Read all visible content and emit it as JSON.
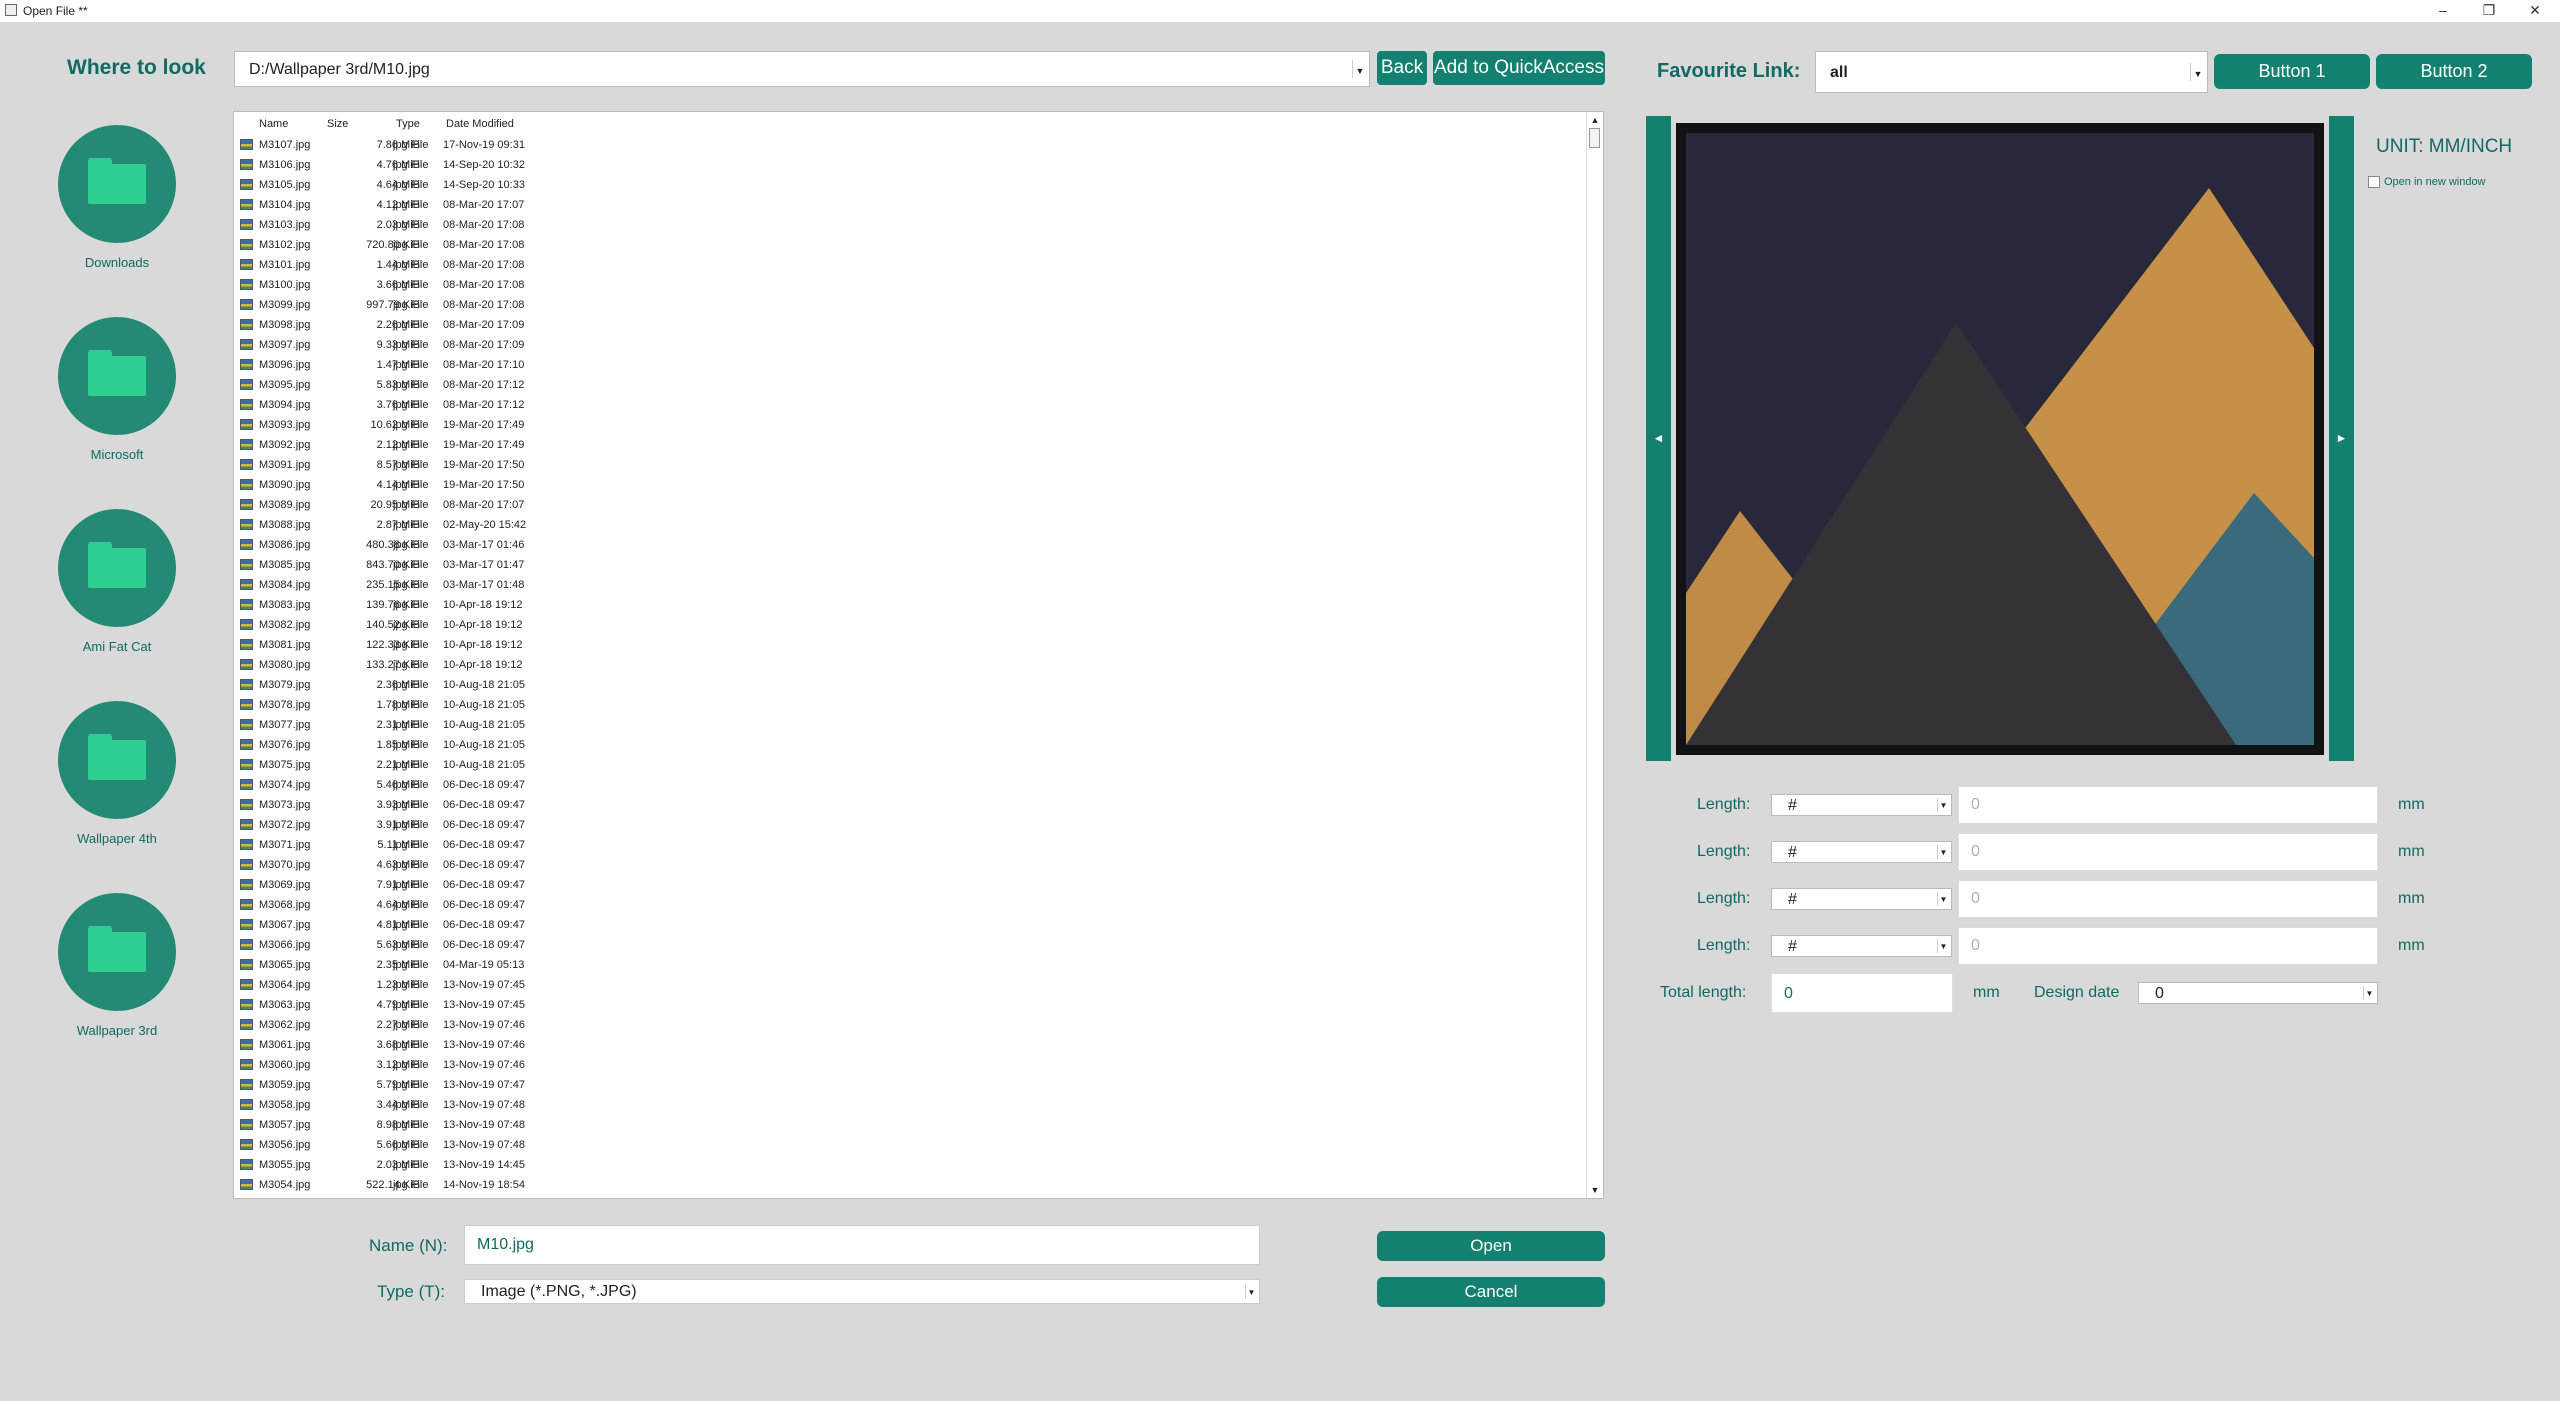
{
  "window": {
    "title": "Open File **",
    "minimize": "–",
    "maximize": "❐",
    "close": "✕"
  },
  "left": {
    "where_label": "Where to look",
    "quick_access": [
      {
        "label": "Downloads"
      },
      {
        "label": "Microsoft"
      },
      {
        "label": "Ami Fat Cat"
      },
      {
        "label": "Wallpaper 4th"
      },
      {
        "label": "Wallpaper 3rd"
      }
    ]
  },
  "path": {
    "value": "D:/Wallpaper 3rd/M10.jpg",
    "back_label": "Back",
    "add_quick_access_label": "Add to QuickAccess"
  },
  "files": {
    "headers": {
      "name": "Name",
      "size": "Size",
      "type": "Type",
      "date": "Date Modified"
    },
    "rows": [
      [
        "M3107.jpg",
        "7.86 MiB",
        "jpg File",
        "17-Nov-19 09:31"
      ],
      [
        "M3106.jpg",
        "4.76 MiB",
        "jpg File",
        "14-Sep-20 10:32"
      ],
      [
        "M3105.jpg",
        "4.64 MiB",
        "jpg File",
        "14-Sep-20 10:33"
      ],
      [
        "M3104.jpg",
        "4.12 MiB",
        "jpg File",
        "08-Mar-20 17:07"
      ],
      [
        "M3103.jpg",
        "2.03 MiB",
        "jpg File",
        "08-Mar-20 17:08"
      ],
      [
        "M3102.jpg",
        "720.80 KiB",
        "jpg File",
        "08-Mar-20 17:08"
      ],
      [
        "M3101.jpg",
        "1.44 MiB",
        "jpg File",
        "08-Mar-20 17:08"
      ],
      [
        "M3100.jpg",
        "3.66 MiB",
        "jpg File",
        "08-Mar-20 17:08"
      ],
      [
        "M3099.jpg",
        "997.79 KiB",
        "jpg File",
        "08-Mar-20 17:08"
      ],
      [
        "M3098.jpg",
        "2.26 MiB",
        "jpg File",
        "08-Mar-20 17:09"
      ],
      [
        "M3097.jpg",
        "9.33 MiB",
        "jpg File",
        "08-Mar-20 17:09"
      ],
      [
        "M3096.jpg",
        "1.47 MiB",
        "jpg File",
        "08-Mar-20 17:10"
      ],
      [
        "M3095.jpg",
        "5.83 MiB",
        "jpg File",
        "08-Mar-20 17:12"
      ],
      [
        "M3094.jpg",
        "3.76 MiB",
        "jpg File",
        "08-Mar-20 17:12"
      ],
      [
        "M3093.jpg",
        "10.62 MiB",
        "jpg File",
        "19-Mar-20 17:49"
      ],
      [
        "M3092.jpg",
        "2.12 MiB",
        "jpg File",
        "19-Mar-20 17:49"
      ],
      [
        "M3091.jpg",
        "8.57 MiB",
        "jpg File",
        "19-Mar-20 17:50"
      ],
      [
        "M3090.jpg",
        "4.14 MiB",
        "jpg File",
        "19-Mar-20 17:50"
      ],
      [
        "M3089.jpg",
        "20.95 MiB",
        "jpg File",
        "08-Mar-20 17:07"
      ],
      [
        "M3088.jpg",
        "2.87 MiB",
        "jpg File",
        "02-May-20 15:42"
      ],
      [
        "M3086.jpg",
        "480.38 KiB",
        "jpg File",
        "03-Mar-17 01:46"
      ],
      [
        "M3085.jpg",
        "843.70 KiB",
        "jpg File",
        "03-Mar-17 01:47"
      ],
      [
        "M3084.jpg",
        "235.15 KiB",
        "jpg File",
        "03-Mar-17 01:48"
      ],
      [
        "M3083.jpg",
        "139.76 KiB",
        "jpg File",
        "10-Apr-18 19:12"
      ],
      [
        "M3082.jpg",
        "140.52 KiB",
        "jpg File",
        "10-Apr-18 19:12"
      ],
      [
        "M3081.jpg",
        "122.33 KiB",
        "jpg File",
        "10-Apr-18 19:12"
      ],
      [
        "M3080.jpg",
        "133.27 KiB",
        "jpg File",
        "10-Apr-18 19:12"
      ],
      [
        "M3079.jpg",
        "2.36 MiB",
        "jpg File",
        "10-Aug-18 21:05"
      ],
      [
        "M3078.jpg",
        "1.78 MiB",
        "jpg File",
        "10-Aug-18 21:05"
      ],
      [
        "M3077.jpg",
        "2.31 MiB",
        "jpg File",
        "10-Aug-18 21:05"
      ],
      [
        "M3076.jpg",
        "1.85 MiB",
        "jpg File",
        "10-Aug-18 21:05"
      ],
      [
        "M3075.jpg",
        "2.21 MiB",
        "jpg File",
        "10-Aug-18 21:05"
      ],
      [
        "M3074.jpg",
        "5.46 MiB",
        "jpg File",
        "06-Dec-18 09:47"
      ],
      [
        "M3073.jpg",
        "3.93 MiB",
        "jpg File",
        "06-Dec-18 09:47"
      ],
      [
        "M3072.jpg",
        "3.91 MiB",
        "jpg File",
        "06-Dec-18 09:47"
      ],
      [
        "M3071.jpg",
        "5.11 MiB",
        "jpg File",
        "06-Dec-18 09:47"
      ],
      [
        "M3070.jpg",
        "4.63 MiB",
        "jpg File",
        "06-Dec-18 09:47"
      ],
      [
        "M3069.jpg",
        "7.91 MiB",
        "jpg File",
        "06-Dec-18 09:47"
      ],
      [
        "M3068.jpg",
        "4.64 MiB",
        "jpg File",
        "06-Dec-18 09:47"
      ],
      [
        "M3067.jpg",
        "4.81 MiB",
        "jpg File",
        "06-Dec-18 09:47"
      ],
      [
        "M3066.jpg",
        "5.63 MiB",
        "jpg File",
        "06-Dec-18 09:47"
      ],
      [
        "M3065.jpg",
        "2.35 MiB",
        "jpg File",
        "04-Mar-19 05:13"
      ],
      [
        "M3064.jpg",
        "1.23 MiB",
        "jpg File",
        "13-Nov-19 07:45"
      ],
      [
        "M3063.jpg",
        "4.79 MiB",
        "jpg File",
        "13-Nov-19 07:45"
      ],
      [
        "M3062.jpg",
        "2.27 MiB",
        "jpg File",
        "13-Nov-19 07:46"
      ],
      [
        "M3061.jpg",
        "3.68 MiB",
        "jpg File",
        "13-Nov-19 07:46"
      ],
      [
        "M3060.jpg",
        "3.12 MiB",
        "jpg File",
        "13-Nov-19 07:46"
      ],
      [
        "M3059.jpg",
        "5.79 MiB",
        "jpg File",
        "13-Nov-19 07:47"
      ],
      [
        "M3058.jpg",
        "3.44 MiB",
        "jpg File",
        "13-Nov-19 07:48"
      ],
      [
        "M3057.jpg",
        "8.98 MiB",
        "jpg File",
        "13-Nov-19 07:48"
      ],
      [
        "M3056.jpg",
        "5.66 MiB",
        "jpg File",
        "13-Nov-19 07:48"
      ],
      [
        "M3055.jpg",
        "2.03 MiB",
        "jpg File",
        "13-Nov-19 14:45"
      ],
      [
        "M3054.jpg",
        "522.14 KiB",
        "jpg File",
        "14-Nov-19 18:54"
      ]
    ]
  },
  "bottom": {
    "name_label": "Name (N):",
    "name_value": "M10.jpg",
    "type_label": "Type (T):",
    "type_value": "Image (*.PNG, *.JPG)",
    "open_label": "Open",
    "cancel_label": "Cancel"
  },
  "right": {
    "favourite_label": "Favourite Link:",
    "favourite_value": "all",
    "button1_label": "Button 1",
    "button2_label": "Button 2",
    "unit_label": "UNIT: MM/INCH",
    "open_new_window_label": "Open in new window",
    "prev_glyph": "◄",
    "next_glyph": "►",
    "lengths": [
      {
        "label": "Length:",
        "select": "#",
        "value": "0",
        "unit": "mm"
      },
      {
        "label": "Length:",
        "select": "#",
        "value": "0",
        "unit": "mm"
      },
      {
        "label": "Length:",
        "select": "#",
        "value": "0",
        "unit": "mm"
      },
      {
        "label": "Length:",
        "select": "#",
        "value": "0",
        "unit": "mm"
      }
    ],
    "total_label": "Total length:",
    "total_value": "0",
    "total_unit": "mm",
    "design_date_label": "Design date",
    "design_date_value": "0"
  },
  "icons": {
    "dropdown": "chevron-down-icon",
    "folder": "folder-icon",
    "file": "image-file-icon"
  },
  "colors": {
    "accent": "#14806f",
    "label_text": "#0f6a62",
    "folder_circle": "#238a75",
    "folder_fill": "#2fcf93"
  }
}
